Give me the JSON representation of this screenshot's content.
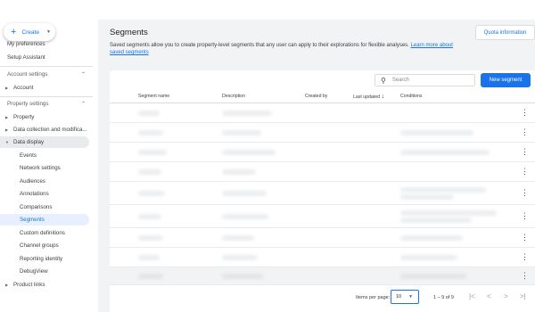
{
  "sidebar": {
    "create_label": "Create",
    "my_preferences": "My preferences",
    "setup_assistant": "Setup Assistant",
    "account_settings": "Account settings",
    "account": "Account",
    "property_settings": "Property settings",
    "property": "Property",
    "data_collection": "Data collection and modifica...",
    "data_display": "Data display",
    "sub_items": [
      "Events",
      "Network settings",
      "Audiences",
      "Annotations",
      "Comparisons",
      "Segments",
      "Custom definitions",
      "Channel groups",
      "Reporting identity",
      "DebugView"
    ],
    "product_links": "Product links"
  },
  "header": {
    "title": "Segments",
    "quota_label": "Quota information",
    "description": "Saved segments allow you to create property-level segments that any user can apply to their explorations for flexible analyses.",
    "learn_more": "Learn more about saved segments"
  },
  "toolbar": {
    "search_placeholder": "Search",
    "new_segment_label": "New segment"
  },
  "table": {
    "columns": [
      "Segment name",
      "Description",
      "Created by",
      "Last updated",
      "Conditions"
    ],
    "sort_arrow": "↓",
    "row_count": 9
  },
  "pagination": {
    "items_per_page_label": "Items per page:",
    "items_per_page_value": "10",
    "range_text": "1 – 9 of 9",
    "first": "|<",
    "prev": "<",
    "next": ">",
    "last": ">|"
  },
  "colors": {
    "accent": "#1a73e8",
    "selected_bg": "#e8f0fe",
    "highlight_bg": "#e8eaed"
  }
}
